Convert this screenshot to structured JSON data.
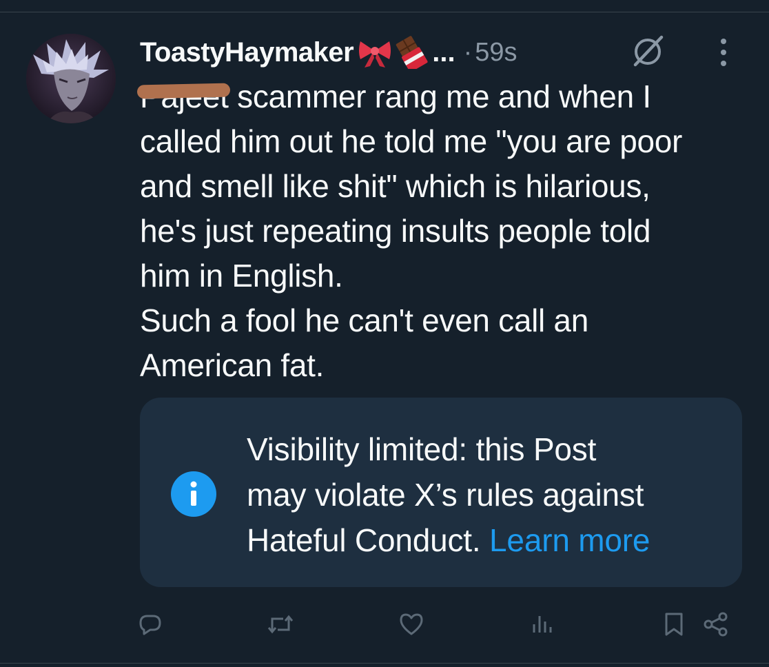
{
  "post": {
    "author": {
      "display_name": "ToastyHaymaker",
      "name_emojis": [
        "ribbon-emoji",
        "chocolate-bar-emoji"
      ],
      "truncation": "..."
    },
    "separator": "·",
    "timestamp": "59s",
    "text": {
      "redacted_word": "Pajeet",
      "line1_rest": " scammer rang me and when I",
      "line2": "called him out he told me \"you are poor",
      "line3": "and smell like shit\" which is hilarious,",
      "line4": "he's just repeating insults people told",
      "line5": "him in English.",
      "line6": "Such a fool he can't even call an",
      "line7": "American fat."
    }
  },
  "notice": {
    "line1": "Visibility limited: this Post",
    "line2": "may violate X’s rules against",
    "line3": "Hateful Conduct.",
    "link": "Learn more",
    "icon": "info-icon"
  },
  "actions": [
    "reply-icon",
    "repost-icon",
    "like-icon",
    "views-icon",
    "bookmark-icon",
    "share-icon"
  ],
  "colors": {
    "background": "#15202b",
    "text": "#f7f9f9",
    "muted": "#8b98a5",
    "accent": "#1d9bf0",
    "notice_bg": "#1e2f40",
    "redaction": "#b0714e"
  }
}
